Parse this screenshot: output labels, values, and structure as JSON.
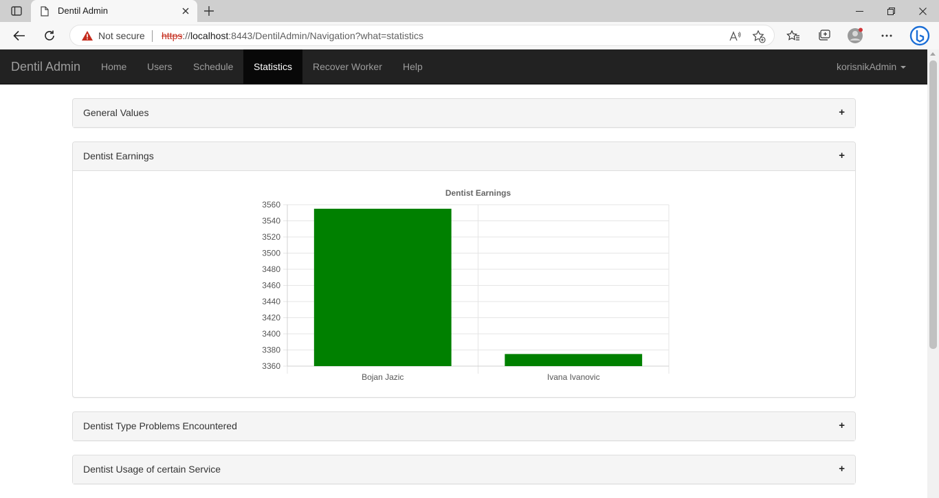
{
  "browser": {
    "tab_title": "Dentil Admin",
    "security_label": "Not secure",
    "url_scheme": "https",
    "url_sep": "://",
    "url_host": "localhost",
    "url_rest": ":8443/DentilAdmin/Navigation?what=statistics"
  },
  "navbar": {
    "brand": "Dentil Admin",
    "items": [
      {
        "label": "Home"
      },
      {
        "label": "Users"
      },
      {
        "label": "Schedule"
      },
      {
        "label": "Statistics"
      },
      {
        "label": "Recover Worker"
      },
      {
        "label": "Help"
      }
    ],
    "active_item": "Statistics",
    "user": "korisnikAdmin"
  },
  "panels": [
    {
      "title": "General Values",
      "toggle": "+"
    },
    {
      "title": "Dentist Earnings",
      "toggle": "+"
    },
    {
      "title": "Dentist Type Problems Encountered",
      "toggle": "+"
    },
    {
      "title": "Dentist Usage of certain Service",
      "toggle": "+"
    }
  ],
  "chart_data": {
    "type": "bar",
    "title": "Dentist Earnings",
    "categories": [
      "Bojan Jazic",
      "Ivana Ivanovic"
    ],
    "values": [
      3555,
      3375
    ],
    "ylim": [
      3360,
      3560
    ],
    "yticks": [
      3360,
      3380,
      3400,
      3420,
      3440,
      3460,
      3480,
      3500,
      3520,
      3540,
      3560
    ],
    "bar_color": "#008000",
    "grid": true,
    "legend": "none"
  }
}
